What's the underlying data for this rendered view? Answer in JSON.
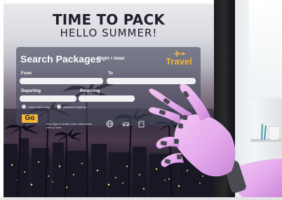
{
  "hero": {
    "title": "TIME TO PACK",
    "subtitle": "HELLO  SUMMER!"
  },
  "panel": {
    "title": "Search Packages",
    "subtitle": "Flight + Hotel",
    "brand": "Travel",
    "from_label": "From",
    "to_label": "To",
    "departing_label": "Departing",
    "returning_label": "Returning",
    "option_one": "Direct flights only",
    "option_two": "Advanced Options",
    "go_label": "Go",
    "go_note": "Your flight is linked, then hotel rooms, cars & more"
  },
  "icons": [
    "globe-icon",
    "car-icon",
    "hotel-icon"
  ],
  "colors": {
    "accent": "#f3b53c",
    "panel": "#46485c",
    "robot_hand": "#e4a9ec",
    "robot_joint": "#4a4a52"
  }
}
